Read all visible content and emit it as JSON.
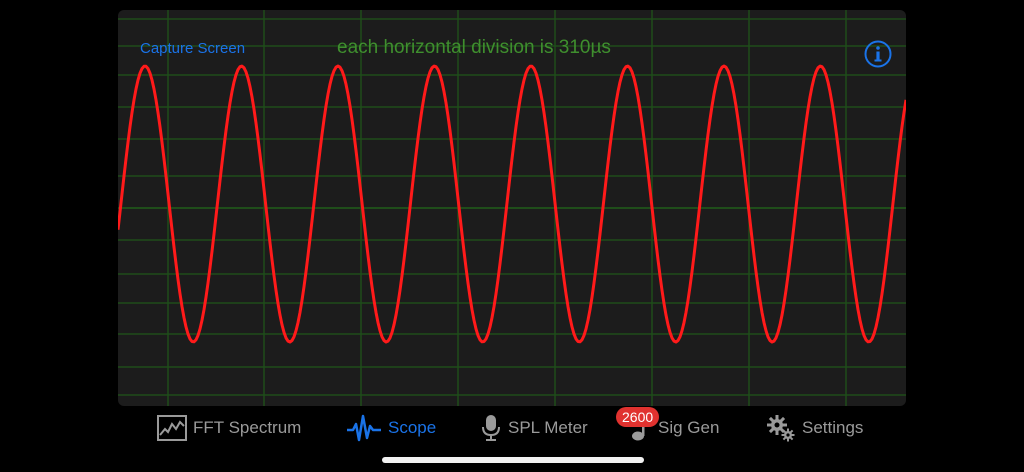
{
  "scope": {
    "capture_label": "Capture Screen",
    "division_label": "each horizontal division is 310µs",
    "trace_color": "#ff1a1a",
    "grid_color": "#1f4d1a",
    "signal": {
      "cycles_visible": 8.2,
      "amplitude_fraction": 0.73
    }
  },
  "tabs": [
    {
      "label": "FFT Spectrum",
      "icon": "fft-chart-icon",
      "active": false
    },
    {
      "label": "Scope",
      "icon": "scope-wave-icon",
      "active": true
    },
    {
      "label": "SPL Meter",
      "icon": "microphone-icon",
      "active": false
    },
    {
      "label": "Sig Gen",
      "icon": "music-note-icon",
      "active": false,
      "badge": "2600"
    },
    {
      "label": "Settings",
      "icon": "gear-icon",
      "active": false
    }
  ],
  "colors": {
    "accent": "#1a73e8",
    "badge": "#e0322f"
  }
}
